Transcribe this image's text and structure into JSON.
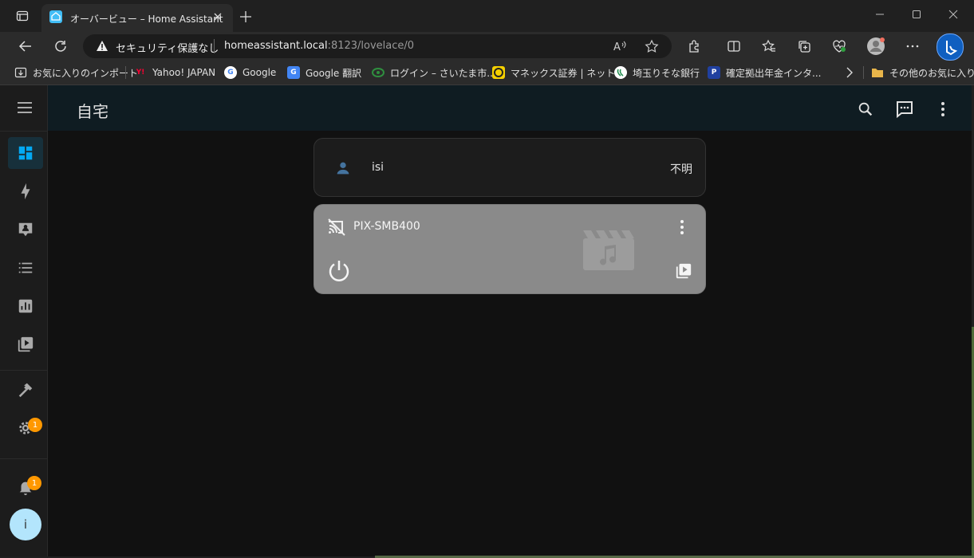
{
  "browser": {
    "tab_title": "オーバービュー – Home Assistant",
    "security_label": "セキュリティ保護なし",
    "url_host": "homeassistant.local",
    "url_rest": ":8123/lovelace/0",
    "icons": [
      "tab-actions-icon",
      "ha-favicon",
      "close-icon",
      "new-tab-icon",
      "minimize-icon",
      "maximize-icon",
      "window-close-icon",
      "back-icon",
      "reload-icon",
      "warning-icon",
      "read-aloud-icon",
      "favorite-star-icon",
      "extensions-icon",
      "split-screen-icon",
      "favorites-icon",
      "collections-icon",
      "browser-essentials-icon",
      "profile-icon",
      "more-icon",
      "bing-icon"
    ]
  },
  "bookmarks": [
    {
      "label": "お気に入りのインポート",
      "icon": "import-icon"
    },
    {
      "label": "Yahoo! JAPAN",
      "icon": "yahoo-icon",
      "mark": "Y!"
    },
    {
      "label": "Google",
      "icon": "google-icon",
      "mark": "G"
    },
    {
      "label": "Google 翻訳",
      "icon": "translate-icon",
      "mark": "G"
    },
    {
      "label": "ログイン – さいたま市...",
      "icon": "saitama-icon"
    },
    {
      "label": "マネックス証券 | ネット...",
      "icon": "monex-icon"
    },
    {
      "label": "埼玉りそな銀行",
      "icon": "resona-icon"
    },
    {
      "label": "確定拠出年金インタ...",
      "icon": "pension-icon",
      "mark": "P"
    },
    {
      "label": "その他のお気に入り",
      "icon": "folder-icon"
    }
  ],
  "ha": {
    "title": "自宅",
    "sidebar_badges": {
      "settings": "1",
      "notifications": "1"
    },
    "user_initial": "i",
    "person_card": {
      "name": "isi",
      "state": "不明"
    },
    "media_card": {
      "name": "PIX-SMB400"
    },
    "colors": {
      "accent": "#03a9f4",
      "person_icon": "#44739e",
      "badge": "#ff9800",
      "header_bg": "#0f1c22",
      "media_card_bg": "#8a8a8a"
    }
  }
}
